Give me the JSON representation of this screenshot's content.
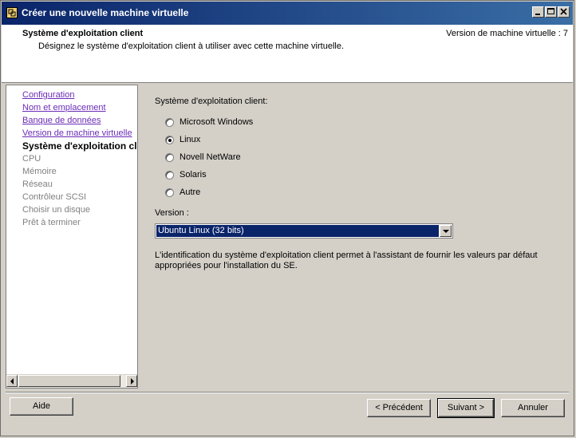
{
  "window": {
    "title": "Créer une nouvelle machine virtuelle"
  },
  "header": {
    "title": "Système d'exploitation client",
    "subtitle": "Désignez le système d'exploitation client à utiliser avec cette machine virtuelle.",
    "version_info": "Version de machine virtuelle : 7"
  },
  "nav": {
    "items": [
      {
        "label": "Configuration",
        "state": "link"
      },
      {
        "label": "Nom et emplacement",
        "state": "link"
      },
      {
        "label": "Banque de données",
        "state": "link"
      },
      {
        "label": "Version de machine virtuelle",
        "state": "link"
      },
      {
        "label": "Système d'exploitation client",
        "state": "active"
      },
      {
        "label": "CPU",
        "state": "disabled"
      },
      {
        "label": "Mémoire",
        "state": "disabled"
      },
      {
        "label": "Réseau",
        "state": "disabled"
      },
      {
        "label": "Contrôleur SCSI",
        "state": "disabled"
      },
      {
        "label": "Choisir un disque",
        "state": "disabled"
      },
      {
        "label": "Prêt à terminer",
        "state": "disabled"
      }
    ]
  },
  "main": {
    "os_label": "Système d'exploitation client:",
    "os_options": [
      {
        "label": "Microsoft Windows",
        "checked": false
      },
      {
        "label": "Linux",
        "checked": true
      },
      {
        "label": "Novell NetWare",
        "checked": false
      },
      {
        "label": "Solaris",
        "checked": false
      },
      {
        "label": "Autre",
        "checked": false
      }
    ],
    "version_label": "Version :",
    "version_value": "Ubuntu Linux (32 bits)",
    "description": "L'identification du système d'exploitation client permet à l'assistant de fournir les valeurs par défaut appropriées pour l'installation du SE."
  },
  "footer": {
    "help": "Aide",
    "back": "< Précédent",
    "next": "Suivant >",
    "cancel": "Annuler"
  }
}
